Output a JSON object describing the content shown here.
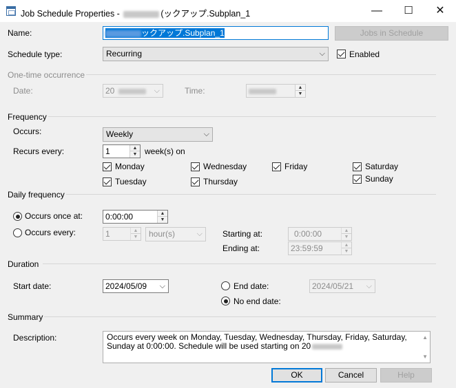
{
  "window": {
    "title_prefix": "Job Schedule Properties -",
    "title_suffix": "(ックアップ.Subplan_1",
    "min_glyph": "—",
    "max_glyph": "☐",
    "close_glyph": "✕"
  },
  "name": {
    "label": "Name:",
    "value": "ックアップ.Subplan_1",
    "jobs_button": "Jobs in Schedule"
  },
  "schedule_type": {
    "label": "Schedule type:",
    "value": "Recurring",
    "enabled_label": "Enabled",
    "enabled": true
  },
  "one_time": {
    "heading": "One-time occurrence",
    "date_label": "Date:",
    "date_value": "20",
    "time_label": "Time:"
  },
  "frequency": {
    "heading": "Frequency",
    "occurs_label": "Occurs:",
    "occurs_value": "Weekly",
    "recurs_label": "Recurs every:",
    "recurs_value": "1",
    "recurs_unit": "week(s) on",
    "days": {
      "monday": {
        "label": "Monday",
        "checked": true
      },
      "tuesday": {
        "label": "Tuesday",
        "checked": true
      },
      "wednesday": {
        "label": "Wednesday",
        "checked": true
      },
      "thursday": {
        "label": "Thursday",
        "checked": true
      },
      "friday": {
        "label": "Friday",
        "checked": true
      },
      "saturday": {
        "label": "Saturday",
        "checked": true
      },
      "sunday": {
        "label": "Sunday",
        "checked": true
      }
    }
  },
  "daily": {
    "heading": "Daily frequency",
    "once_label": "Occurs once at:",
    "once_value": "0:00:00",
    "every_label": "Occurs every:",
    "every_value": "1",
    "every_unit": "hour(s)",
    "starting_label": "Starting at:",
    "starting_value": "0:00:00",
    "ending_label": "Ending at:",
    "ending_value": "23:59:59"
  },
  "duration": {
    "heading": "Duration",
    "start_label": "Start date:",
    "start_value": "2024/05/09",
    "end_label": "End date:",
    "end_value": "2024/05/21",
    "no_end_label": "No end date:"
  },
  "summary": {
    "heading": "Summary",
    "desc_label": "Description:",
    "desc_line1": "Occurs every week on Monday, Tuesday, Wednesday, Thursday, Friday, Saturday,",
    "desc_line2": "Sunday at 0:00:00. Schedule will be used starting on 20"
  },
  "buttons": {
    "ok": "OK",
    "cancel": "Cancel",
    "help": "Help"
  },
  "colors": {
    "accent": "#0078d7",
    "window_bg": "#f0f0f0",
    "disabled_text": "#8c8c8c"
  }
}
